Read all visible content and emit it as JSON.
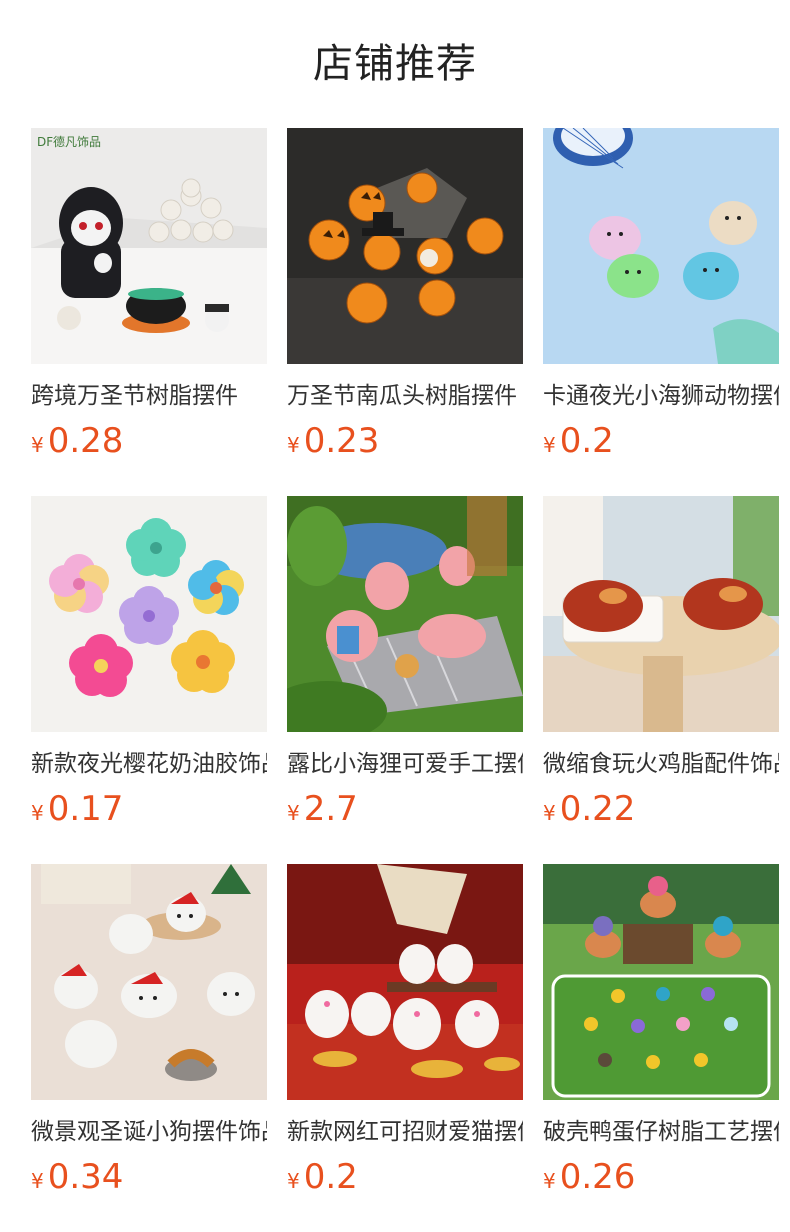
{
  "section": {
    "title": "店铺推荐"
  },
  "products": [
    {
      "name": "跨境万圣节树脂摆件",
      "currency": "¥",
      "price": "0.28",
      "image": "halloween-skeleton-resin-figures",
      "brand": "德凡饰品",
      "bg": "#eceaea"
    },
    {
      "name": "万圣节南瓜头树脂摆件",
      "currency": "¥",
      "price": "0.23",
      "image": "halloween-pumpkin-resin-figures",
      "bg": "#2b2a28"
    },
    {
      "name": "卡通夜光小海狮动物摆件",
      "currency": "¥",
      "price": "0.2",
      "image": "glow-sea-lion-figures",
      "bg": "#b8d7f0"
    },
    {
      "name": "新款夜光樱花奶油胶饰品",
      "currency": "¥",
      "price": "0.17",
      "image": "glow-sakura-flower-charms",
      "bg": "#f2f1ee"
    },
    {
      "name": "露比小海狸可爱手工摆件",
      "currency": "¥",
      "price": "2.7",
      "image": "pink-beaver-picnic-figures",
      "bg": "#4f8a2c"
    },
    {
      "name": "微缩食玩火鸡脂配件饰品",
      "currency": "¥",
      "price": "0.22",
      "image": "miniature-roast-turkey",
      "bg": "#cfdde6"
    },
    {
      "name": "微景观圣诞小狗摆件饰品",
      "currency": "¥",
      "price": "0.34",
      "image": "christmas-puppy-figures",
      "bg": "#eadfd6"
    },
    {
      "name": "新款网红可招财爱猫摆件",
      "currency": "¥",
      "price": "0.2",
      "image": "lucky-cat-figures",
      "bg": "#b9211c"
    },
    {
      "name": "破壳鸭蛋仔树脂工艺摆件",
      "currency": "¥",
      "price": "0.26",
      "image": "hatching-duck-egg-figures",
      "bg": "#5a9a3a"
    }
  ]
}
